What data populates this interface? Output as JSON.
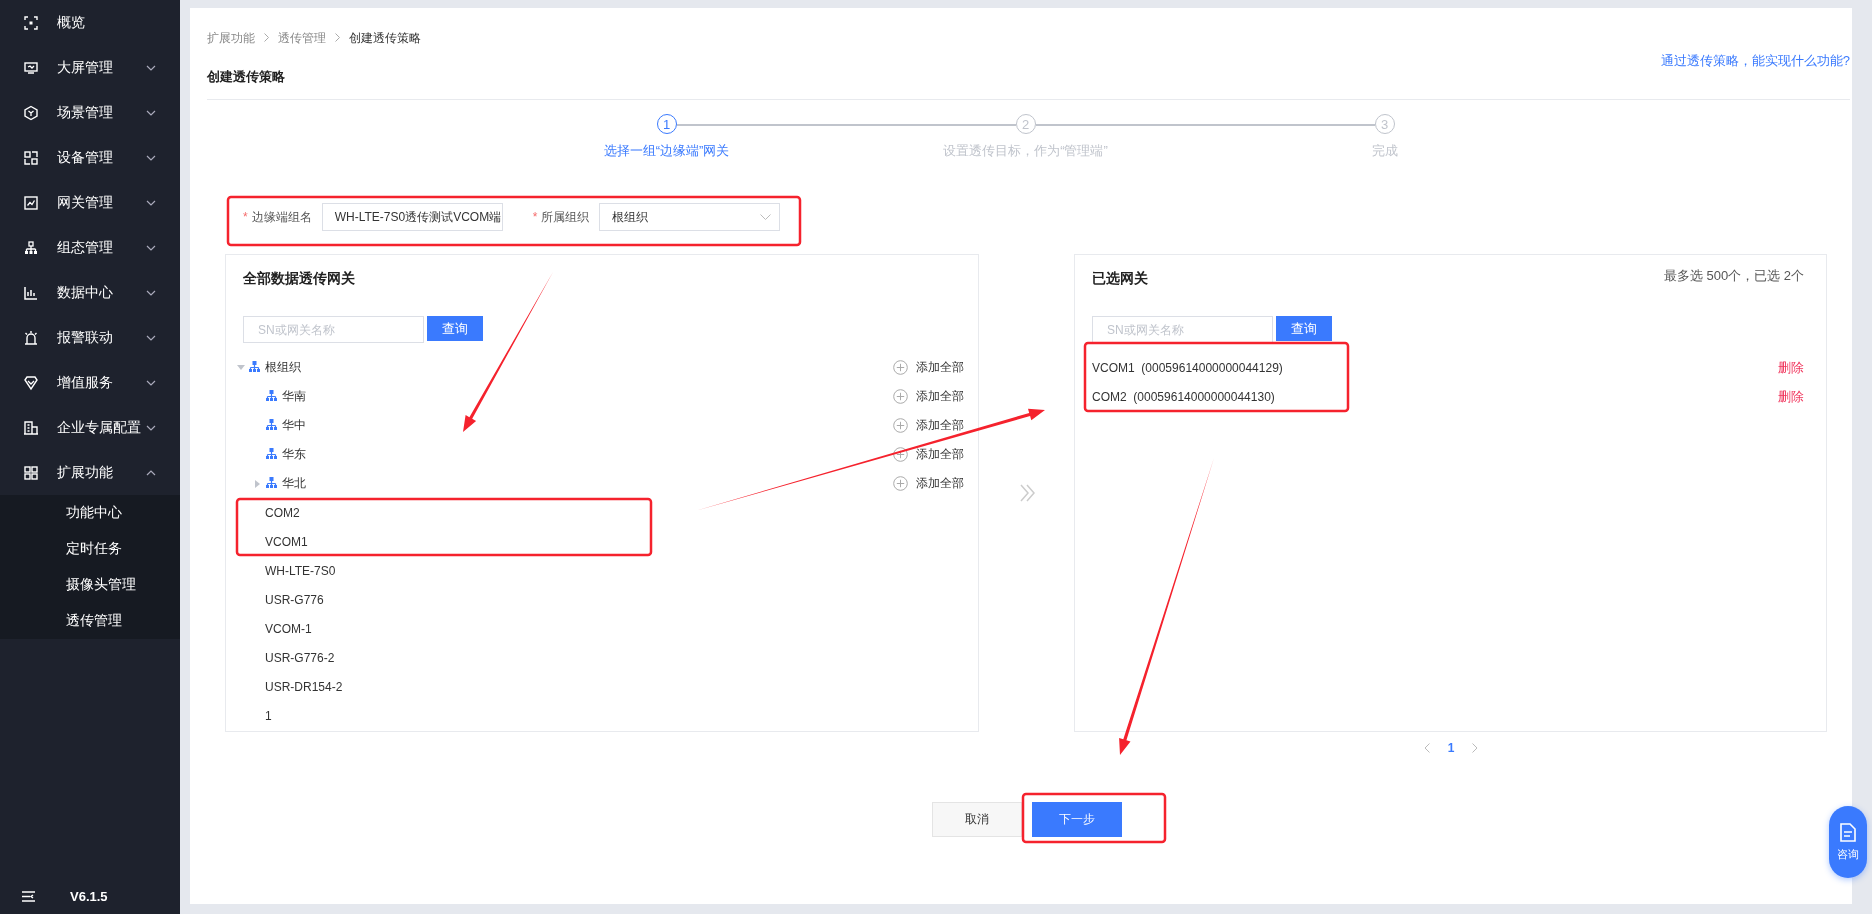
{
  "sidebar": {
    "items": [
      {
        "label": "概览",
        "kind": "link"
      },
      {
        "label": "大屏管理",
        "kind": "group",
        "expanded": false
      },
      {
        "label": "场景管理",
        "kind": "group",
        "expanded": false
      },
      {
        "label": "设备管理",
        "kind": "group",
        "expanded": false
      },
      {
        "label": "网关管理",
        "kind": "group",
        "expanded": false
      },
      {
        "label": "组态管理",
        "kind": "group",
        "expanded": false
      },
      {
        "label": "数据中心",
        "kind": "group",
        "expanded": false
      },
      {
        "label": "报警联动",
        "kind": "group",
        "expanded": false
      },
      {
        "label": "增值服务",
        "kind": "group",
        "expanded": false
      },
      {
        "label": "企业专属配置",
        "kind": "group",
        "expanded": false
      },
      {
        "label": "扩展功能",
        "kind": "group",
        "expanded": true,
        "children": [
          {
            "label": "功能中心"
          },
          {
            "label": "定时任务"
          },
          {
            "label": "摄像头管理"
          },
          {
            "label": "透传管理"
          }
        ]
      }
    ],
    "version": "V6.1.5"
  },
  "breadcrumb": [
    "扩展功能",
    "透传管理",
    "创建透传策略"
  ],
  "page_title": "创建透传策略",
  "help_link": "通过透传策略，能实现什么功能?",
  "steps": [
    {
      "number": "1",
      "label": "选择一组“边缘端”网关",
      "active": true
    },
    {
      "number": "2",
      "label": "设置透传目标，作为“管理端”",
      "active": false
    },
    {
      "number": "3",
      "label": "完成",
      "active": false
    }
  ],
  "form": {
    "fields": [
      {
        "required_mark": "*",
        "label": "边缘端组名",
        "kind": "input",
        "value": "WH-LTE-7S0透传测试VCOM端"
      },
      {
        "required_mark": "*",
        "label": "所属组织",
        "kind": "select",
        "value": "根组织"
      }
    ]
  },
  "left_panel": {
    "title": "全部数据透传网关",
    "search": {
      "placeholder": "SN或网关名称",
      "button": "查询"
    },
    "tree": {
      "label": "根组织",
      "expanded": true,
      "action": "添加全部",
      "children": [
        {
          "label": "华南",
          "action": "添加全部"
        },
        {
          "label": "华中",
          "action": "添加全部"
        },
        {
          "label": "华东",
          "action": "添加全部"
        },
        {
          "label": "华北",
          "expanded": false,
          "action": "添加全部"
        }
      ]
    },
    "gateways": [
      "COM2",
      "VCOM1",
      "WH-LTE-7S0",
      "USR-G776",
      "VCOM-1",
      "USR-G776-2",
      "USR-DR154-2",
      "1"
    ]
  },
  "right_panel": {
    "title": "已选网关",
    "limit": "最多选 500个，已选 2个",
    "search": {
      "placeholder": "SN或网关名称",
      "button": "查询"
    },
    "items": [
      {
        "name": "VCOM1",
        "sn": "(00059614000000044129)",
        "action": "删除"
      },
      {
        "name": "COM2",
        "sn": "(00059614000000044130)",
        "action": "删除"
      }
    ]
  },
  "pagination": {
    "pages": [
      {
        "label": "1",
        "selected": true
      }
    ]
  },
  "buttons": [
    {
      "label": "取消",
      "kind": "default"
    },
    {
      "label": "下一步",
      "kind": "primary"
    }
  ],
  "consult": {
    "label": "咨询"
  }
}
